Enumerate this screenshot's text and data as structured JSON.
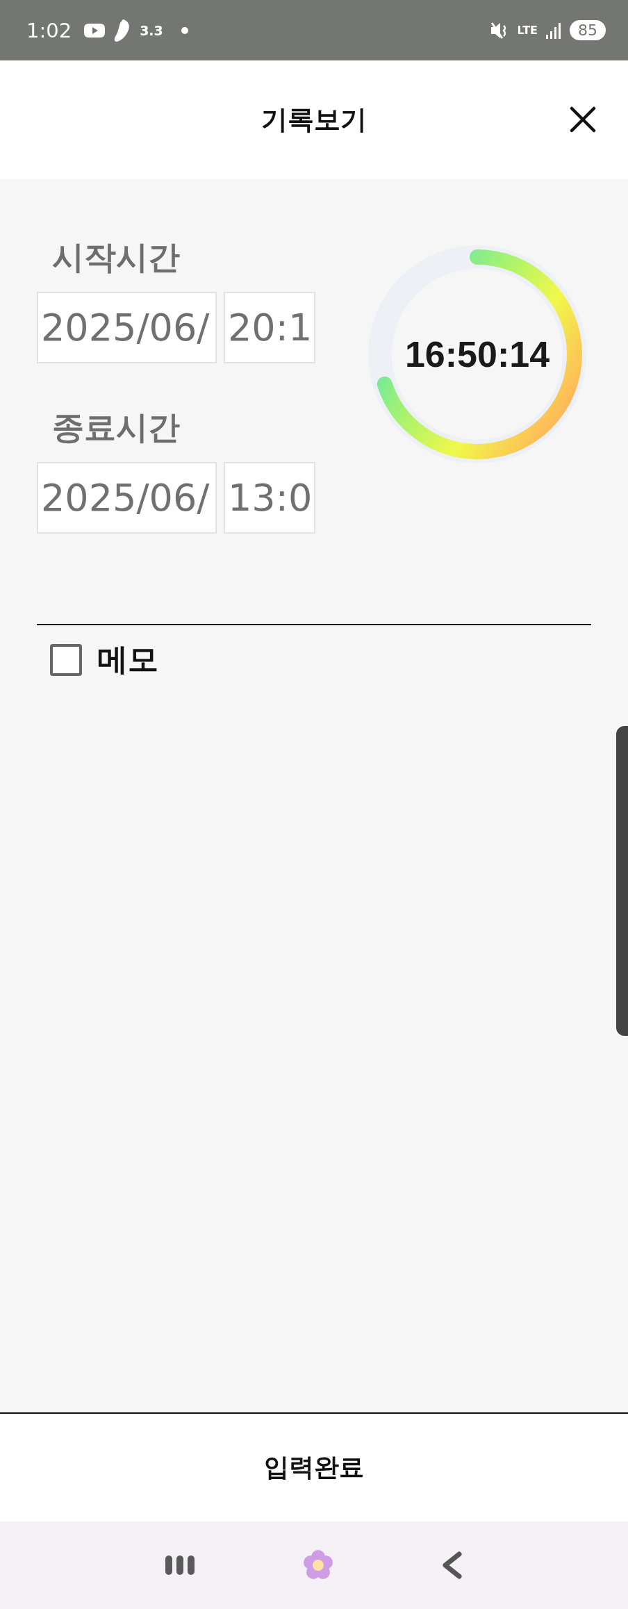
{
  "status_bar": {
    "time": "1:02",
    "step_count": "3.3",
    "network": "LTE",
    "battery": "85"
  },
  "header": {
    "title": "기록보기"
  },
  "start": {
    "label": "시작시간",
    "date": "2025/06/",
    "time": "20:1"
  },
  "end": {
    "label": "종료시간",
    "date": "2025/06/",
    "time": "13:0"
  },
  "timer": {
    "elapsed": "16:50:14",
    "level": 0.7
  },
  "memo": {
    "label": "메모",
    "checked": false
  },
  "submit_button": "입력완료"
}
